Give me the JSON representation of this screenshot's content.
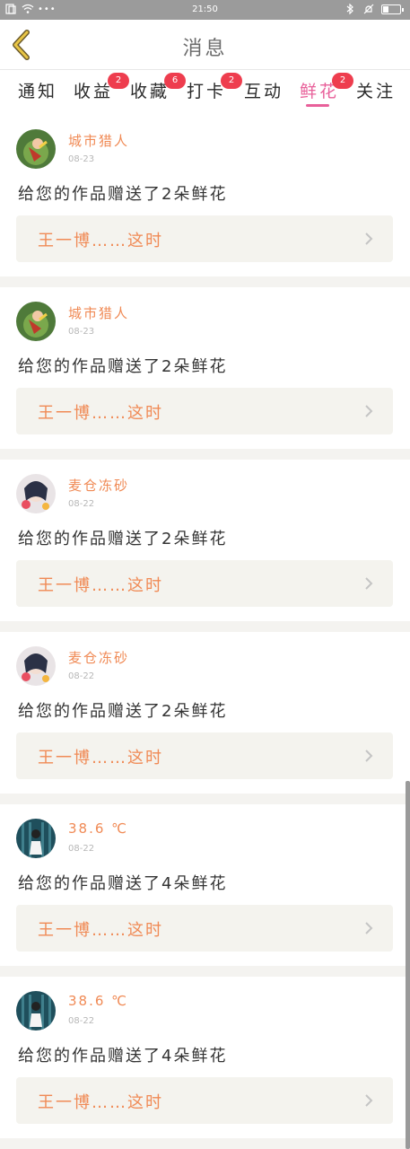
{
  "status_bar": {
    "time": "21:50"
  },
  "header": {
    "title": "消息"
  },
  "tabs": [
    {
      "label": "通知",
      "badge": ""
    },
    {
      "label": "收益",
      "badge": "2"
    },
    {
      "label": "收藏",
      "badge": "6"
    },
    {
      "label": "打卡",
      "badge": "2"
    },
    {
      "label": "互动",
      "badge": ""
    },
    {
      "label": "鲜花",
      "badge": "2",
      "active": true
    },
    {
      "label": "关注",
      "badge": ""
    }
  ],
  "messages": [
    {
      "user": "城市猎人",
      "date": "08-23",
      "text": "给您的作品赠送了2朵鲜花",
      "work": "王一博……这时"
    },
    {
      "user": "城市猎人",
      "date": "08-23",
      "text": "给您的作品赠送了2朵鲜花",
      "work": "王一博……这时"
    },
    {
      "user": "麦仓冻砂",
      "date": "08-22",
      "text": "给您的作品赠送了2朵鲜花",
      "work": "王一博……这时"
    },
    {
      "user": "麦仓冻砂",
      "date": "08-22",
      "text": "给您的作品赠送了2朵鲜花",
      "work": "王一博……这时"
    },
    {
      "user": "38.6 ℃",
      "date": "08-22",
      "text": "给您的作品赠送了4朵鲜花",
      "work": "王一博……这时"
    },
    {
      "user": "38.6 ℃",
      "date": "08-22",
      "text": "给您的作品赠送了4朵鲜花",
      "work": "王一博……这时"
    }
  ],
  "colors": {
    "accent": "#e8609a",
    "username": "#f08a55",
    "badge": "#ee3d4e"
  }
}
